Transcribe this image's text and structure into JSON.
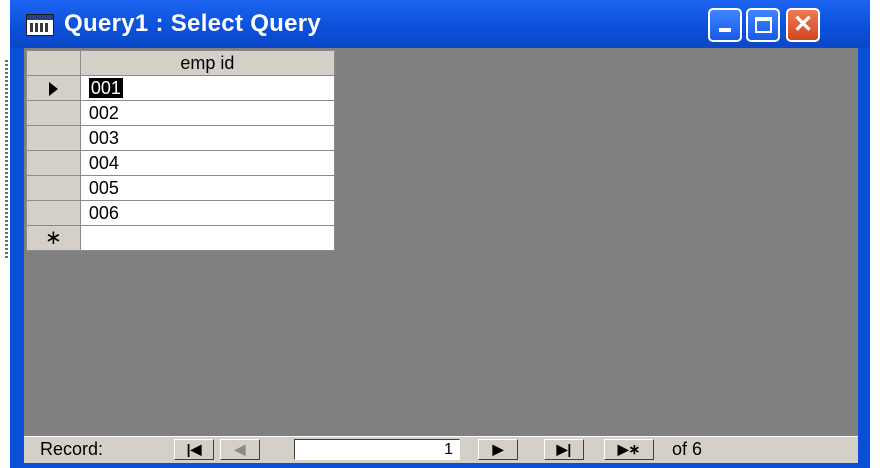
{
  "window": {
    "title": "Query1 : Select Query",
    "close_glyph": "✕"
  },
  "datasheet": {
    "column_header": "emp id",
    "rows": [
      {
        "emp_id": "001",
        "current": true
      },
      {
        "emp_id": "002"
      },
      {
        "emp_id": "003"
      },
      {
        "emp_id": "004"
      },
      {
        "emp_id": "005"
      },
      {
        "emp_id": "006"
      }
    ],
    "new_record_glyph": "∗"
  },
  "navigation": {
    "label": "Record:",
    "first_glyph": "|◀",
    "prev_glyph": "◀",
    "current_record": "1",
    "next_glyph": "▶",
    "last_glyph": "▶|",
    "new_glyph": "▶∗",
    "of_text": "of  6"
  },
  "colors": {
    "title_bar": "#0a4fd6",
    "client_background": "#808080",
    "button_face": "#d4d0c8",
    "close_button": "#d0471f"
  }
}
